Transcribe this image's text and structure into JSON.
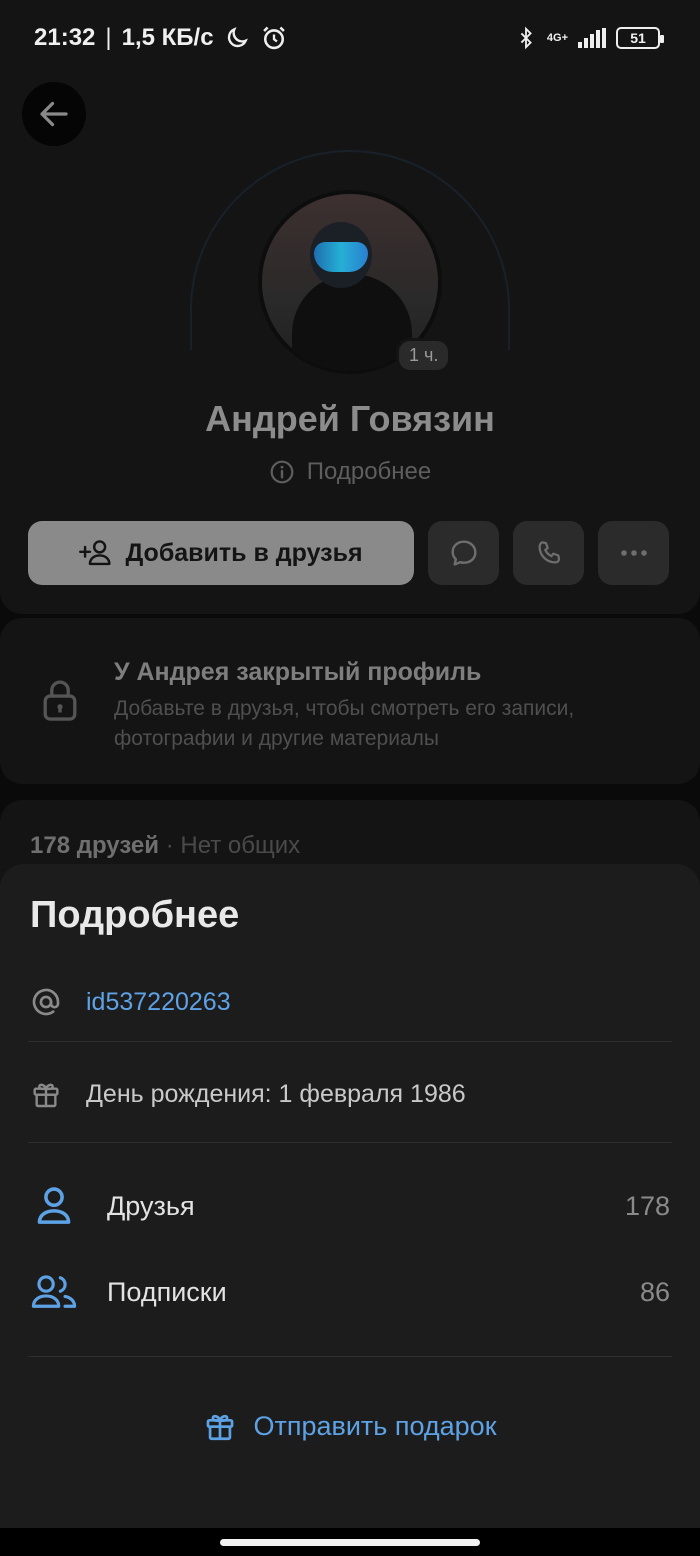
{
  "status_bar": {
    "time": "21:32",
    "separator": "|",
    "speed": "1,5 КБ/с",
    "network": "4G+",
    "battery": "51"
  },
  "profile": {
    "name": "Андрей Говязин",
    "time_badge": "1 ч.",
    "more_label": "Подробнее",
    "add_friend_label": "Добавить в друзья"
  },
  "closed_profile": {
    "title": "У Андрея закрытый профиль",
    "text": "Добавьте в друзья, чтобы смотреть его записи, фотографии и другие материалы"
  },
  "friends": {
    "count_label": "178 друзей",
    "common_label": "· Нет общих"
  },
  "sheet": {
    "title": "Подробнее",
    "id": "id537220263",
    "birthday": "День рождения: 1 февраля 1986",
    "stats": [
      {
        "label": "Друзья",
        "value": "178"
      },
      {
        "label": "Подписки",
        "value": "86"
      }
    ],
    "gift_label": "Отправить подарок"
  },
  "colors": {
    "accent": "#5ea2e6",
    "sheet_bg": "#1c1c1c",
    "dimmed_bg": "#141414"
  }
}
